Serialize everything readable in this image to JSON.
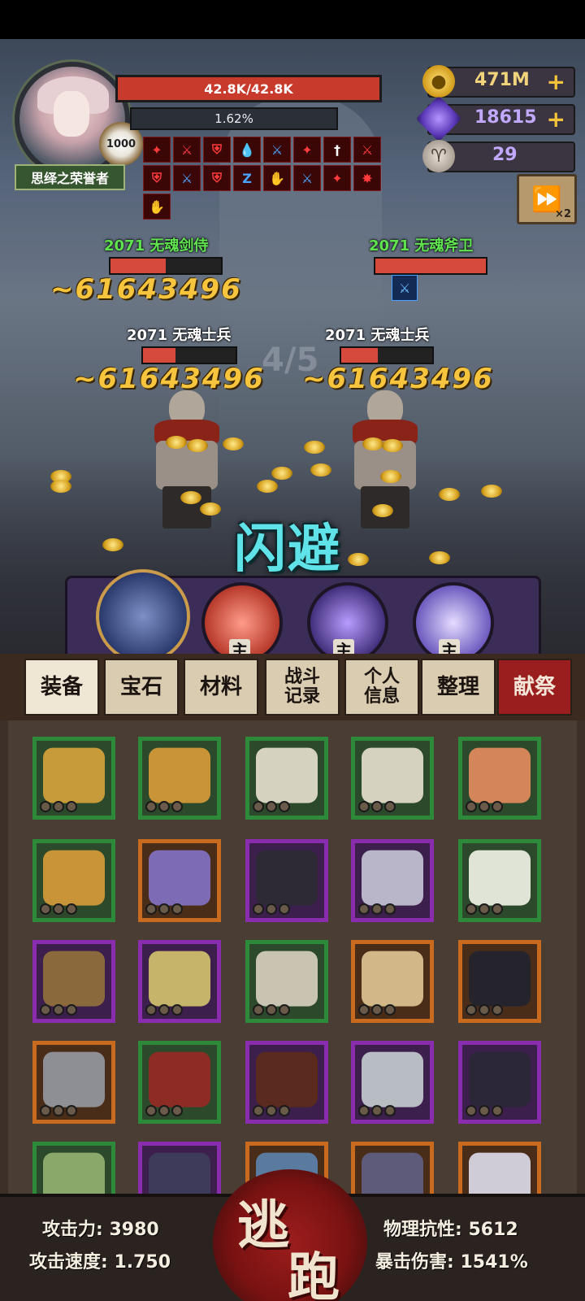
{
  "player": {
    "title": "思绎之荣誉者",
    "level_badge": "1000",
    "hp_text": "42.8K/42.8K",
    "xp_text": "1.62%",
    "buffs": [
      {
        "icon": "attack-up-icon",
        "glyph": "✦",
        "tone": "red"
      },
      {
        "icon": "sword-up-icon",
        "glyph": "⚔",
        "tone": "red"
      },
      {
        "icon": "shield-up-icon",
        "glyph": "⛨",
        "tone": "red"
      },
      {
        "icon": "blood-up-icon",
        "glyph": "💧",
        "tone": "red"
      },
      {
        "icon": "sword-down-icon",
        "glyph": "⚔",
        "tone": "blue"
      },
      {
        "icon": "attack-up-icon",
        "glyph": "✦",
        "tone": "red"
      },
      {
        "icon": "dagger-up-icon",
        "glyph": "†",
        "tone": "white"
      },
      {
        "icon": "sword-up-icon",
        "glyph": "⚔",
        "tone": "red"
      },
      {
        "icon": "shield-up-icon",
        "glyph": "⛨",
        "tone": "red"
      },
      {
        "icon": "sword-down-icon",
        "glyph": "⚔",
        "tone": "blue"
      },
      {
        "icon": "shield-up-icon",
        "glyph": "⛨",
        "tone": "red"
      },
      {
        "icon": "speed-down-icon",
        "glyph": "Z",
        "tone": "blue"
      },
      {
        "icon": "hand-up-icon",
        "glyph": "✋",
        "tone": "red"
      },
      {
        "icon": "sword-down-icon",
        "glyph": "⚔",
        "tone": "blue"
      },
      {
        "icon": "attack-up-icon",
        "glyph": "✦",
        "tone": "red"
      },
      {
        "icon": "crit-up-icon",
        "glyph": "✸",
        "tone": "red"
      },
      {
        "icon": "hand-up-icon",
        "glyph": "✋",
        "tone": "red"
      }
    ]
  },
  "resources": {
    "gold": "471M",
    "gems": "18615",
    "keys": "29",
    "plus": "+"
  },
  "speed_button": {
    "glyph": "⏩",
    "multiplier": "×2"
  },
  "stage": "4/5",
  "enemies": [
    {
      "name": "2071 无魂剑侍",
      "damage": "~61643496",
      "hp_fraction": 0.5,
      "color": "green"
    },
    {
      "name": "2071 无魂斧卫",
      "damage": "",
      "hp_fraction": 1.0,
      "color": "green"
    },
    {
      "name": "2071 无魂士兵",
      "damage": "~61643496",
      "hp_fraction": 0.35,
      "color": "white"
    },
    {
      "name": "2071 无魂士兵",
      "damage": "~61643496",
      "hp_fraction": 0.4,
      "color": "white"
    }
  ],
  "dodge_text": "闪避",
  "heroes": [
    {
      "name": "wolf-hero",
      "tag": ""
    },
    {
      "name": "fox-hero",
      "tag": "主"
    },
    {
      "name": "shadow-hero",
      "tag": "主"
    },
    {
      "name": "orb-hero",
      "tag": "主"
    }
  ],
  "tabs": [
    {
      "label": "装备",
      "style": "active"
    },
    {
      "label": "宝石",
      "style": ""
    },
    {
      "label": "材料",
      "style": ""
    },
    {
      "label": "战斗\n记录",
      "style": "sm"
    },
    {
      "label": "个人\n信息",
      "style": "sm"
    },
    {
      "label": "整理",
      "style": ""
    },
    {
      "label": "献祭",
      "style": "red"
    }
  ],
  "inventory": [
    {
      "item": "gold-belt",
      "rarity": "green",
      "color": "#c79a3a"
    },
    {
      "item": "golden-boots",
      "rarity": "green",
      "color": "#c99438"
    },
    {
      "item": "bone-chestplate",
      "rarity": "green",
      "color": "#d6d2c0"
    },
    {
      "item": "bone-chestplate",
      "rarity": "green",
      "color": "#d6d2c0"
    },
    {
      "item": "orange-robe",
      "rarity": "green",
      "color": "#d4865a"
    },
    {
      "item": "golden-boots",
      "rarity": "green",
      "color": "#c99438"
    },
    {
      "item": "purple-belt",
      "rarity": "orange",
      "color": "#7d6bb5"
    },
    {
      "item": "dark-boots",
      "rarity": "purple",
      "color": "#2d2a35"
    },
    {
      "item": "silver-ring",
      "rarity": "purple",
      "color": "#b9b6c9"
    },
    {
      "item": "white-pants",
      "rarity": "green",
      "color": "#dfe4d6"
    },
    {
      "item": "crossbow",
      "rarity": "purple",
      "color": "#8a6a3d"
    },
    {
      "item": "star-amulet",
      "rarity": "purple",
      "color": "#c6b46a"
    },
    {
      "item": "skull-belt",
      "rarity": "green",
      "color": "#c9c3b2"
    },
    {
      "item": "straw-hat",
      "rarity": "orange",
      "color": "#d2b889"
    },
    {
      "item": "black-boots",
      "rarity": "orange",
      "color": "#25242c"
    },
    {
      "item": "iron-helm",
      "rarity": "orange",
      "color": "#8e8f95"
    },
    {
      "item": "red-armor",
      "rarity": "green",
      "color": "#8d2b25"
    },
    {
      "item": "bone-belt",
      "rarity": "purple",
      "color": "#5a2a1e"
    },
    {
      "item": "steel-gauntlets",
      "rarity": "purple",
      "color": "#b8bcc3"
    },
    {
      "item": "horned-helm",
      "rarity": "purple",
      "color": "#2b2638"
    },
    {
      "item": "beast-armor",
      "rarity": "green",
      "color": "#8aa86a"
    },
    {
      "item": "spiked-crown",
      "rarity": "purple",
      "color": "#3e3a5a"
    },
    {
      "item": "dragon-ring",
      "rarity": "orange",
      "color": "#5b7aa0"
    },
    {
      "item": "cloth-belt",
      "rarity": "orange",
      "color": "#5e5a7a"
    },
    {
      "item": "bone-ornament",
      "rarity": "orange",
      "color": "#cfcbd7"
    }
  ],
  "stats": {
    "attack": "攻击力: 3980",
    "attack_speed": "攻击速度: 1.750",
    "phys_res": "物理抗性: 5612",
    "crit_dmg": "暴击伤害: 1541%"
  },
  "escape": {
    "char1": "逃",
    "char2": "跑"
  }
}
